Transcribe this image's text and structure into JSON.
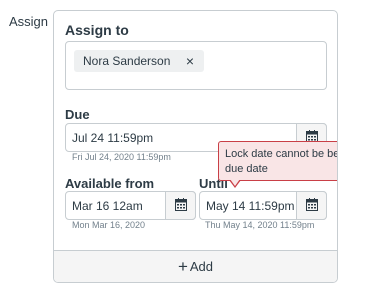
{
  "side_label": "Assign",
  "assign_to": {
    "title": "Assign to",
    "token": "Nora Sanderson",
    "remove_symbol": "×"
  },
  "due": {
    "label": "Due",
    "value": "Jul 24 11:59pm",
    "hint": "Fri Jul 24, 2020 11:59pm"
  },
  "available_from": {
    "label": "Available from",
    "value": "Mar 16 12am",
    "hint": "Mon Mar 16, 2020"
  },
  "until": {
    "label": "Until",
    "value": "May 14 11:59pm",
    "hint": "Thu May 14, 2020 11:59pm"
  },
  "tooltip": {
    "text": "Lock date cannot be before due date",
    "border_color": "#c93f46",
    "background": "#f9e5e6"
  },
  "add": {
    "symbol": "+",
    "label": "Add"
  },
  "icons": {
    "calendar": "calendar-icon",
    "remove": "close-icon",
    "add": "plus-icon"
  }
}
